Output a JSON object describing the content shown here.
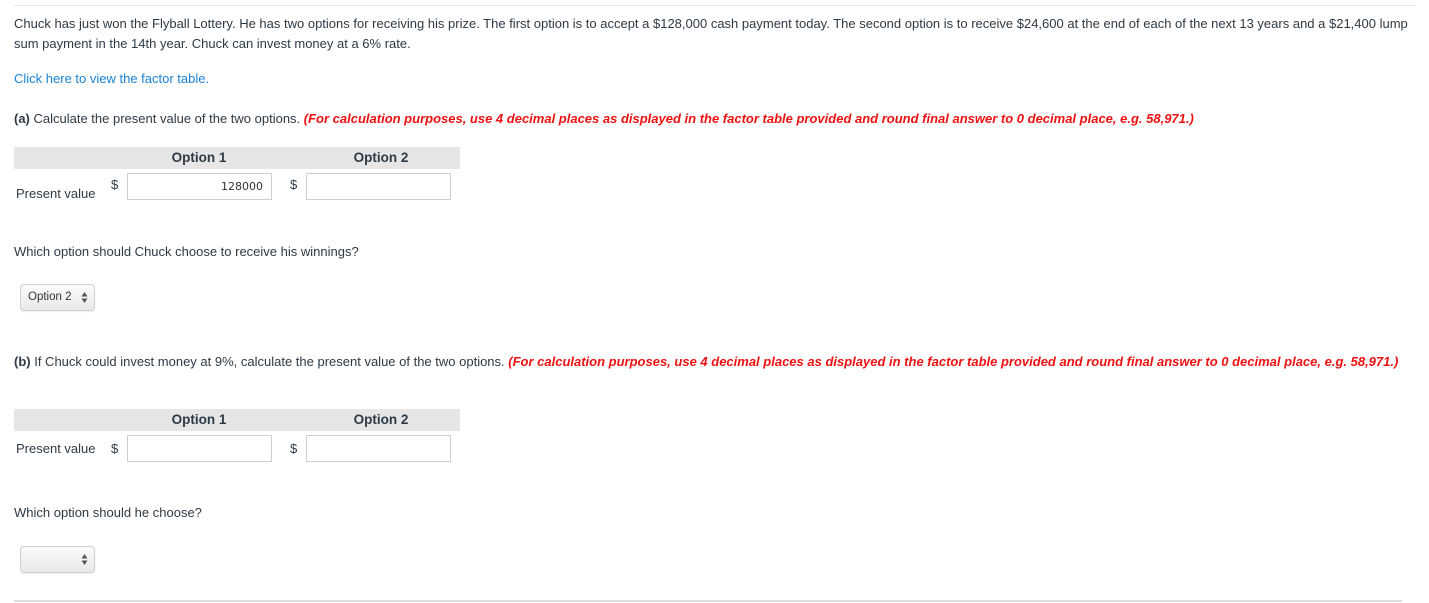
{
  "problem": {
    "text": "Chuck has just won the Flyball Lottery. He has two options for receiving his prize. The first option is to accept a $128,000 cash payment today. The second option is to receive $24,600 at the end of each of the next 13 years and a $21,400 lump sum payment in the 14th year. Chuck can invest money at a 6% rate.",
    "factor_link": "Click here to view the factor table."
  },
  "part_a": {
    "letter": "(a)",
    "prompt": " Calculate the present value of the two options. ",
    "instruction": "(For calculation purposes, use 4 decimal places as displayed in the factor table provided and round final answer to 0 decimal place, e.g. 58,971.)",
    "table": {
      "columns": [
        "Option 1",
        "Option 2"
      ],
      "row_label": "Present value",
      "currency": "$",
      "option1_value": "128000",
      "option2_value": ""
    },
    "question": "Which option should Chuck choose to receive his winnings?",
    "selected_option": "Option 2"
  },
  "part_b": {
    "letter": "(b)",
    "prompt": " If Chuck could invest money at 9%, calculate the present value of the two options. ",
    "instruction": "(For calculation purposes, use 4 decimal places as displayed in the factor table provided and round final answer to 0 decimal place, e.g. 58,971.)",
    "table": {
      "columns": [
        "Option 1",
        "Option 2"
      ],
      "row_label": "Present value",
      "currency": "$",
      "option1_value": "",
      "option2_value": ""
    },
    "question": "Which option should he choose?",
    "selected_option": ""
  },
  "colors": {
    "text": "#2d3a45",
    "link": "#1a82d6",
    "instruction": "#ee1111",
    "table_header_bg": "#e6e6e6"
  }
}
